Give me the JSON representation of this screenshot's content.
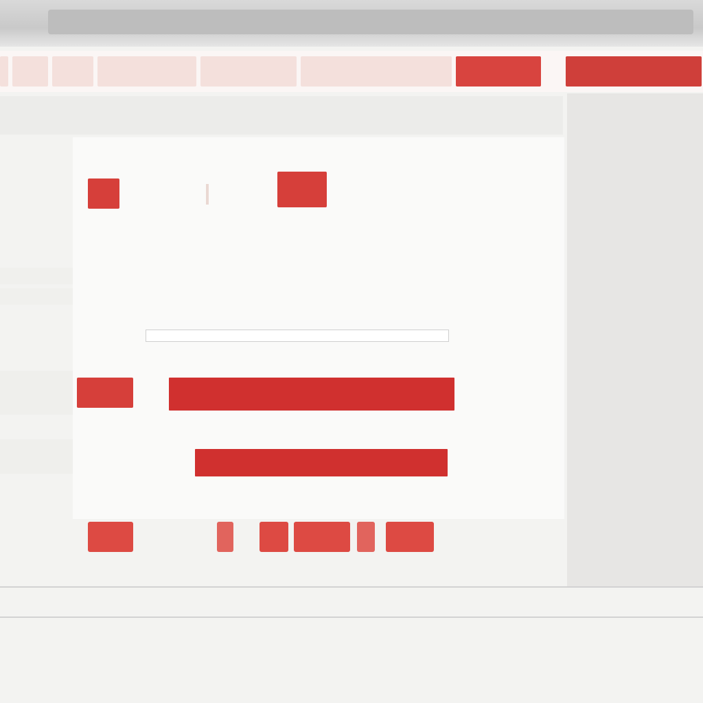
{
  "nav": {
    "items": [
      "",
      "",
      "",
      "",
      "",
      "",
      "",
      ""
    ],
    "active_label": "",
    "header_label": ""
  },
  "panel": {
    "row1": {
      "label_a": "",
      "label_b": ""
    },
    "row2": {
      "button_a": "",
      "button_b": ""
    },
    "row3": {
      "label": "",
      "text": ""
    },
    "row4": {
      "text_a": "",
      "text_b": ""
    },
    "row5": {
      "label_a": "",
      "label_b": "",
      "field_a": "",
      "field_b": ""
    },
    "row6": {
      "label": "",
      "field": ""
    },
    "row7": {
      "label_a": "",
      "label_b": "",
      "field": ""
    },
    "row8": {
      "label": "",
      "value": ""
    }
  },
  "tabs": {
    "labels": [
      "",
      "",
      "",
      "",
      "",
      ""
    ]
  },
  "footer": {
    "text": ""
  },
  "colors": {
    "accent": "#d63f3a",
    "accent_light": "#f4e0dc",
    "background": "#f3f3f1"
  }
}
